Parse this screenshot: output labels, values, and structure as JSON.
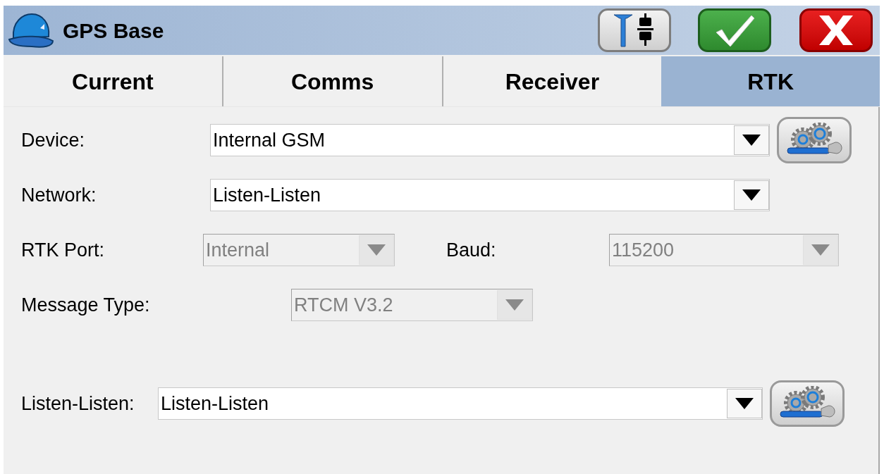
{
  "window": {
    "title": "GPS Base"
  },
  "tabs": [
    {
      "label": "Current",
      "selected": false
    },
    {
      "label": "Comms",
      "selected": false
    },
    {
      "label": "Receiver",
      "selected": false
    },
    {
      "label": "RTK",
      "selected": true
    }
  ],
  "rows": [
    {
      "kind": "full",
      "settings_button": true,
      "fields": [
        {
          "label": "Device:",
          "value": "Internal GSM",
          "disabled": false
        }
      ]
    },
    {
      "kind": "full",
      "settings_button": false,
      "fields": [
        {
          "label": "Network:",
          "value": "Listen-Listen",
          "disabled": false
        }
      ]
    },
    {
      "kind": "pair",
      "settings_button": false,
      "fields": [
        {
          "label": "RTK Port:",
          "value": "Internal",
          "disabled": true
        },
        {
          "label": "Baud:",
          "value": "115200",
          "disabled": true
        }
      ]
    },
    {
      "kind": "indent",
      "settings_button": false,
      "fields": [
        {
          "label": "Message Type:",
          "value": "RTCM V3.2",
          "disabled": true
        }
      ]
    },
    {
      "kind": "inline",
      "settings_button": true,
      "fields": [
        {
          "label": "Listen-Listen:",
          "value": "Listen-Listen",
          "disabled": false
        }
      ]
    }
  ]
}
